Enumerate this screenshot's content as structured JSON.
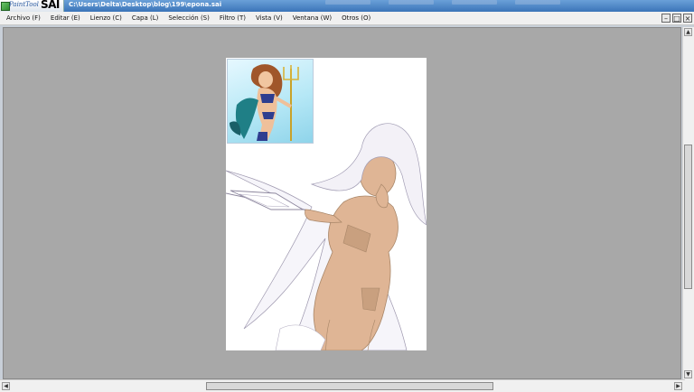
{
  "app": {
    "logo_text": "PaintTool",
    "logo_brand": "SAI",
    "title": "C:\\Users\\Delta\\Desktop\\blog\\199\\epona.sai"
  },
  "menu": [
    {
      "label": "Archivo (F)"
    },
    {
      "label": "Editar (E)"
    },
    {
      "label": "Lienzo (C)"
    },
    {
      "label": "Capa (L)"
    },
    {
      "label": "Selección (S)"
    },
    {
      "label": "Filtro (T)"
    },
    {
      "label": "Vista (V)"
    },
    {
      "label": "Ventana (W)"
    },
    {
      "label": "Otros (O)"
    }
  ],
  "window_controls": {
    "minimize": "–",
    "restore": "□",
    "close": "×"
  },
  "scrollbar": {
    "up": "▲",
    "down": "▼",
    "left": "◀",
    "right": "▶"
  },
  "colors": {
    "workspace_bg": "#a8a8a8",
    "canvas_bg": "#ffffff",
    "skin": "#dfb595",
    "hair": "#f3f1f7",
    "lineart": "#8d879e"
  }
}
